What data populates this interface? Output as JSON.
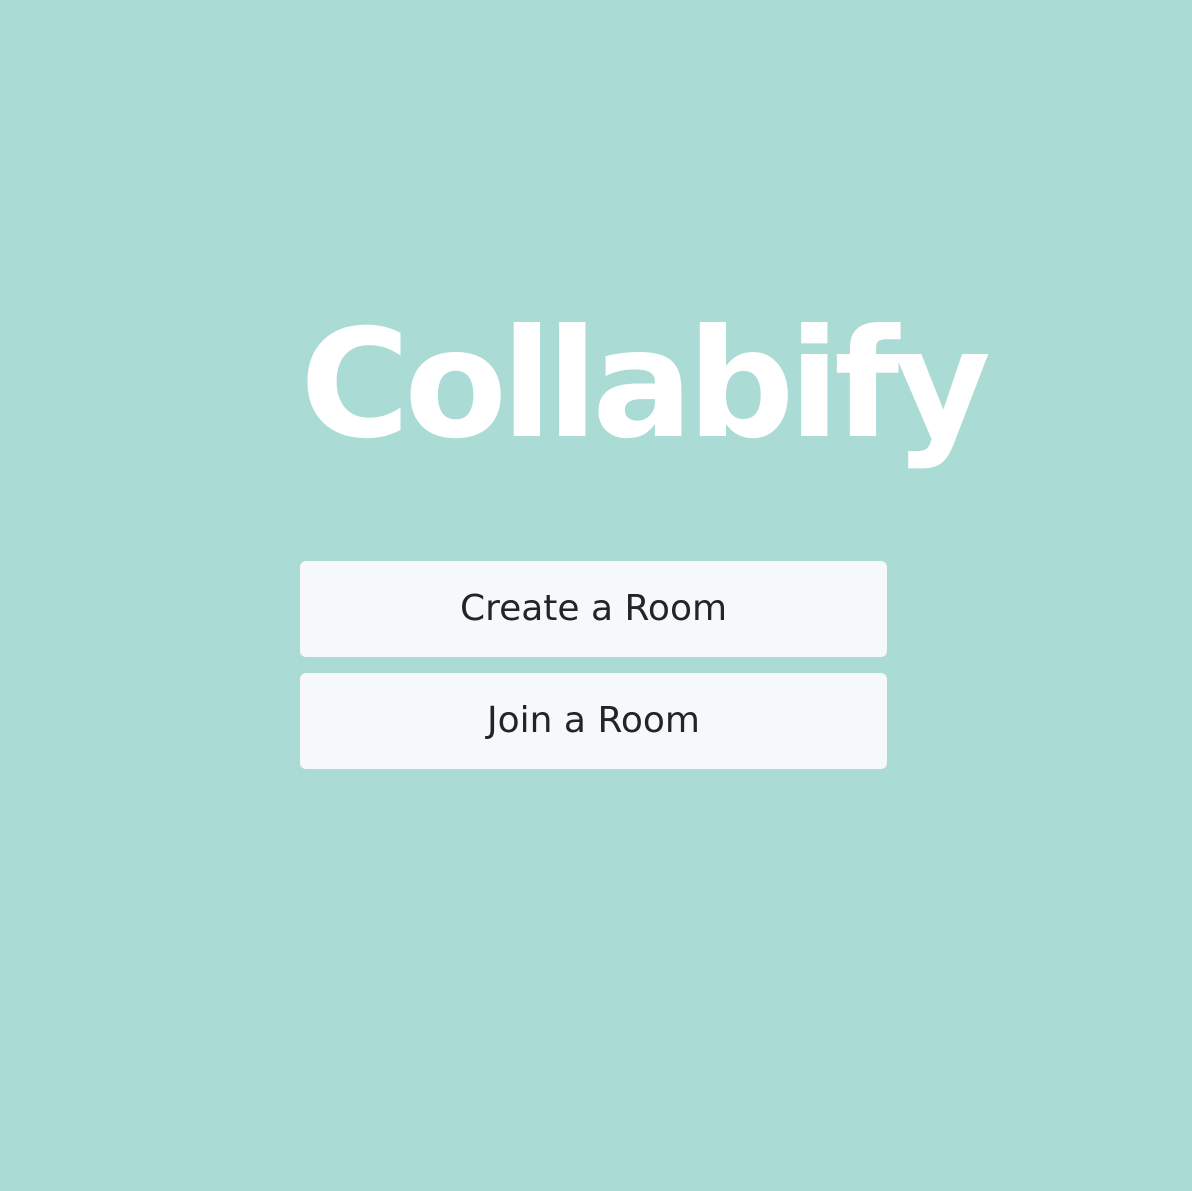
{
  "app": {
    "logo_text": "Collabify"
  },
  "actions": {
    "create_label": "Create a Room",
    "join_label": "Join a Room"
  },
  "colors": {
    "background": "#abdbd5",
    "logo": "#ffffff",
    "button_bg": "#f7f8fa",
    "button_text": "#212529"
  }
}
